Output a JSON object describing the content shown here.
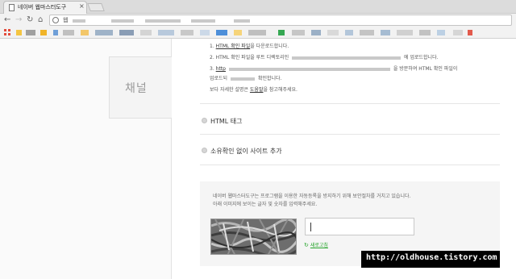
{
  "browser": {
    "tab_title": "네이버 웹마스터도구",
    "tab_close": "×",
    "url_visible": "웹",
    "nav": {
      "back": "←",
      "forward": "→",
      "reload": "↻",
      "home": "⌂"
    }
  },
  "sidebar": {
    "channel_label": "채널"
  },
  "instructions": {
    "step1_num": "1.",
    "step1_link": "HTML 확인 파일",
    "step1_tail": "을 다운로드합니다.",
    "step2_text": "2. HTML 확인 파일을 루트 디렉토리인",
    "step2_tail": "에 업로드합니다.",
    "step3_prefix": "3.",
    "step3_link": "http",
    "step3_tail": "을 방문하여 HTML 확인 파일이",
    "step3_line2": "업로드되",
    "step3_line2_tail": "확인합니다.",
    "more_prefix": "보다 자세한 설명은",
    "more_link": "도움말",
    "more_suffix": "을 참고해주세요."
  },
  "options": [
    {
      "label": "HTML 태그"
    },
    {
      "label": "소유확인 없이 사이트 추가"
    }
  ],
  "captcha": {
    "note_line1": "네이버 웹마스터도구는 프로그램을 이용한 자동등록을 방지하기 위해 보안절차를 거치고 있습니다.",
    "note_line2": "아래 이미지에 보이는 글자 및 숫자를 입력해주세요.",
    "refresh_label": "새로고침",
    "refresh_icon": "refresh-icon"
  },
  "watermark": {
    "text": "http://oldhouse.tistory.com"
  },
  "colors": {
    "link_green": "#26a52b",
    "apps_red": "#e34b3b"
  }
}
